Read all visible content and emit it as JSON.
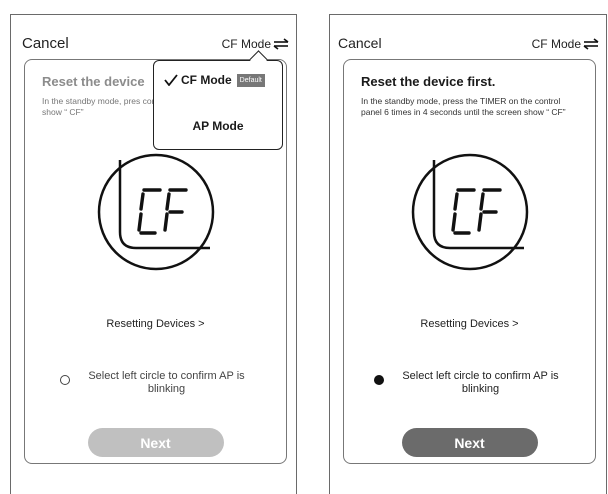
{
  "left": {
    "cancel_label": "Cancel",
    "mode_label": "CF Mode",
    "card": {
      "title": "Reset the device",
      "description": "In the standby mode, pres control panel 6 times in screen show “ CF”"
    },
    "display_text": "CF",
    "resetting_link": "Resetting Devices >",
    "confirm_text": "Select left circle to confirm AP is blinking",
    "confirm_checked": false,
    "next_label": "Next",
    "next_enabled": false,
    "dropdown": {
      "items": [
        {
          "label": "CF Mode",
          "selected": true,
          "badge": "Default"
        },
        {
          "label": "AP Mode",
          "selected": false
        }
      ]
    }
  },
  "right": {
    "cancel_label": "Cancel",
    "mode_label": "CF Mode",
    "card": {
      "title": "Reset the device first.",
      "description": "In the standby mode, press the TIMER on the control panel 6 times in 4 seconds until the screen show “ CF”"
    },
    "display_text": "CF",
    "resetting_link": "Resetting Devices >",
    "confirm_text": "Select left circle to confirm AP is blinking",
    "confirm_checked": true,
    "next_label": "Next",
    "next_enabled": true
  },
  "icons": {
    "mode_switch": "swap-arrows-icon",
    "check": "checkmark-icon",
    "radio": "radio-icon",
    "device_display": "seven-segment-display-icon"
  },
  "colors": {
    "next_disabled": "#c0c0c0",
    "next_enabled": "#6b6b6b",
    "badge": "#777777"
  }
}
